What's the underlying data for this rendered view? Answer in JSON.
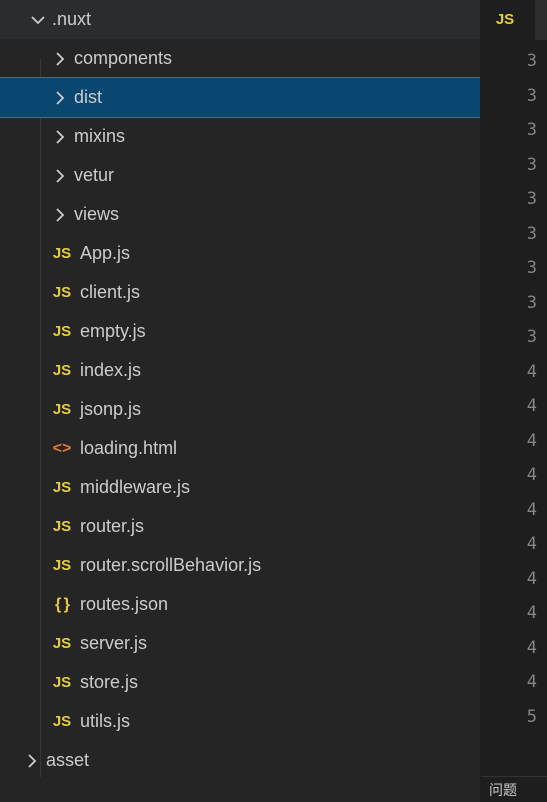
{
  "sidebar": {
    "root": {
      "name": ".nuxt",
      "expanded": true
    },
    "items": [
      {
        "name": "components",
        "type": "folder"
      },
      {
        "name": "dist",
        "type": "folder",
        "selected": true
      },
      {
        "name": "mixins",
        "type": "folder"
      },
      {
        "name": "vetur",
        "type": "folder"
      },
      {
        "name": "views",
        "type": "folder"
      },
      {
        "name": "App.js",
        "type": "js"
      },
      {
        "name": "client.js",
        "type": "js"
      },
      {
        "name": "empty.js",
        "type": "js"
      },
      {
        "name": "index.js",
        "type": "js"
      },
      {
        "name": "jsonp.js",
        "type": "js"
      },
      {
        "name": "loading.html",
        "type": "html"
      },
      {
        "name": "middleware.js",
        "type": "js"
      },
      {
        "name": "router.js",
        "type": "js"
      },
      {
        "name": "router.scrollBehavior.js",
        "type": "js"
      },
      {
        "name": "routes.json",
        "type": "json"
      },
      {
        "name": "server.js",
        "type": "js"
      },
      {
        "name": "store.js",
        "type": "js"
      },
      {
        "name": "utils.js",
        "type": "js"
      }
    ],
    "sibling": {
      "name": "asset",
      "type": "folder"
    }
  },
  "editor": {
    "tab_icon": "JS",
    "line_numbers": [
      "3",
      "3",
      "3",
      "3",
      "3",
      "3",
      "3",
      "3",
      "3",
      "4",
      "4",
      "4",
      "4",
      "4",
      "4",
      "4",
      "4",
      "4",
      "4",
      "5"
    ]
  },
  "panel": {
    "label": "问题"
  },
  "icons": {
    "js": "JS",
    "html": "<>",
    "json": "{ }"
  }
}
